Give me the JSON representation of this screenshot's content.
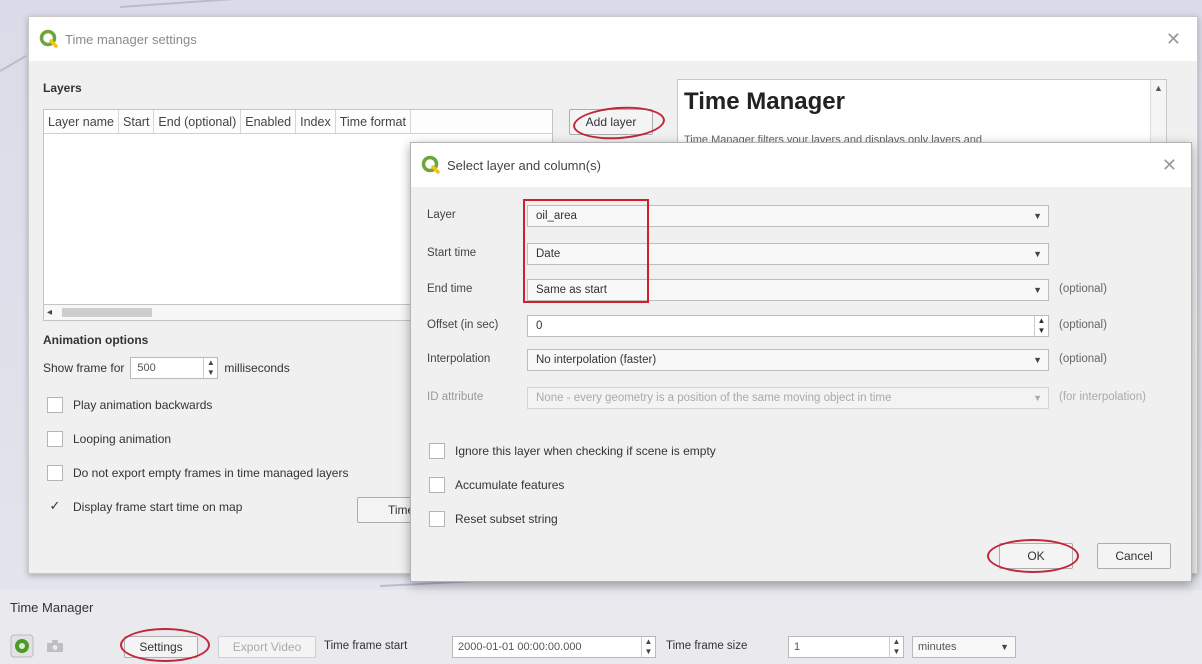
{
  "main_dialog": {
    "title": "Time manager settings",
    "close": "✕",
    "layers_label": "Layers",
    "columns": [
      "Layer name",
      "Start",
      "End (optional)",
      "Enabled",
      "Index",
      "Time format"
    ],
    "add_layer": "Add layer",
    "help_title": "Time Manager",
    "help_text": "Time Manager filters your layers and displays only layers and",
    "animation_label": "Animation options",
    "show_frame_for": "Show frame for",
    "frame_ms": "500",
    "milliseconds": "milliseconds",
    "options": [
      {
        "label": "Play animation backwards",
        "checked": false
      },
      {
        "label": "Looping animation",
        "checked": false
      },
      {
        "label": "Do not export empty frames in time managed layers",
        "checked": false
      },
      {
        "label": "Display frame start time on map",
        "checked": true
      }
    ],
    "time_button": "Time",
    "check_mark": "✓"
  },
  "select_dialog": {
    "title": "Select layer and column(s)",
    "close": "✕",
    "fields": {
      "layer": {
        "label": "Layer",
        "value": "oil_area"
      },
      "start_time": {
        "label": "Start time",
        "value": "Date"
      },
      "end_time": {
        "label": "End time",
        "value": "Same as start",
        "note": "(optional)"
      },
      "offset": {
        "label": "Offset (in sec)",
        "value": "0",
        "note": "(optional)"
      },
      "interpolation": {
        "label": "Interpolation",
        "value": "No interpolation (faster)",
        "note": "(optional)"
      },
      "id_attribute": {
        "label": "ID attribute",
        "value": "None - every geometry is a position of the same moving object in time",
        "note": "(for interpolation)"
      }
    },
    "checkboxes": [
      {
        "label": "Ignore this layer when checking if scene is empty",
        "checked": false
      },
      {
        "label": "Accumulate features",
        "checked": false
      },
      {
        "label": "Reset subset string",
        "checked": false
      }
    ],
    "ok": "OK",
    "cancel": "Cancel"
  },
  "bottom_panel": {
    "title": "Time Manager",
    "settings": "Settings",
    "export_video": "Export Video",
    "time_frame_start_label": "Time frame start",
    "time_frame_start": "2000-01-01 00:00:00.000",
    "time_frame_size_label": "Time frame size",
    "time_frame_size": "1",
    "unit": "minutes"
  },
  "colors": {
    "annotation_red": "#d11f2b",
    "qgis_green": "#6ca63c",
    "power_green": "#4c9a2a"
  }
}
